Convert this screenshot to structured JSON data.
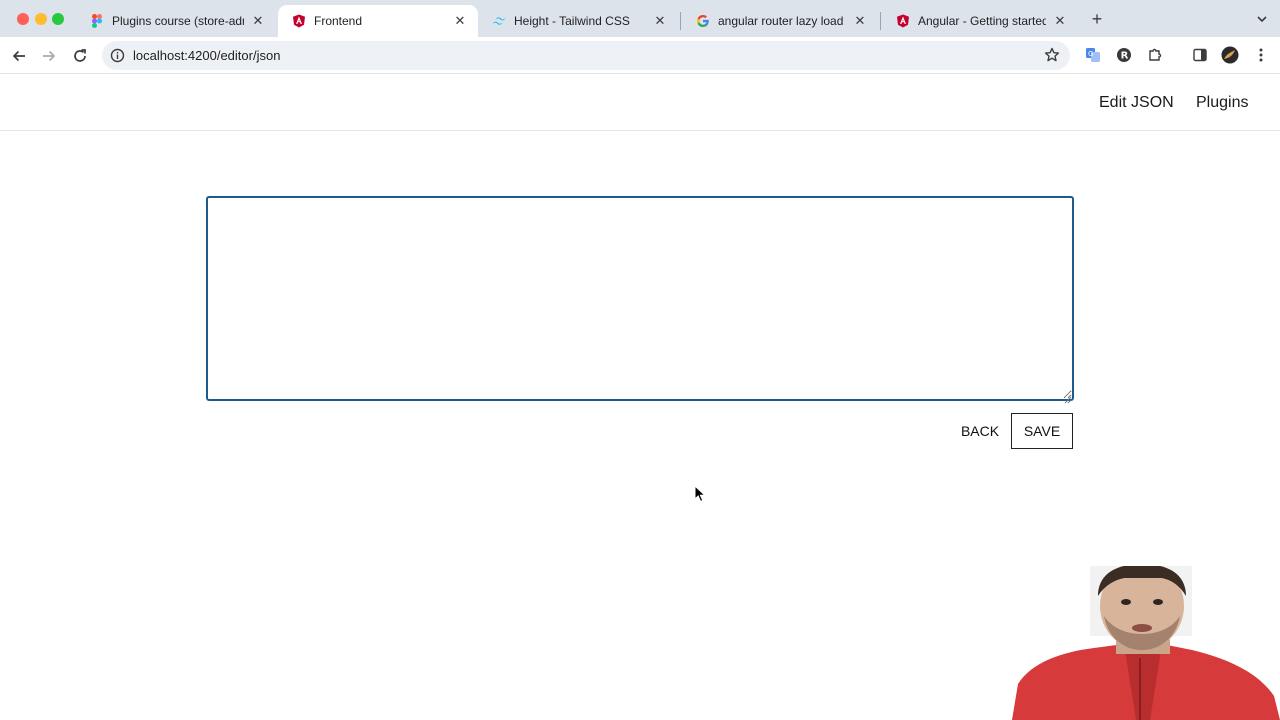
{
  "browser": {
    "tabs": [
      {
        "title": "Plugins course (store-admin-",
        "favicon": "figma-icon",
        "active": false
      },
      {
        "title": "Frontend",
        "favicon": "angular-icon",
        "active": true
      },
      {
        "title": "Height - Tailwind CSS",
        "favicon": "tailwind-icon",
        "active": false
      },
      {
        "title": "angular router lazy load stanc",
        "favicon": "google-icon",
        "active": false
      },
      {
        "title": "Angular - Getting started with",
        "favicon": "angular-icon",
        "active": false
      }
    ],
    "url": "localhost:4200/editor/json"
  },
  "nav": {
    "edit_json": "Edit JSON",
    "plugins": "Plugins"
  },
  "editor": {
    "value": ""
  },
  "actions": {
    "back": "BACK",
    "save": "SAVE"
  },
  "colors": {
    "accent_border": "#1f5b8a",
    "tab_strip": "#dde3ea"
  }
}
